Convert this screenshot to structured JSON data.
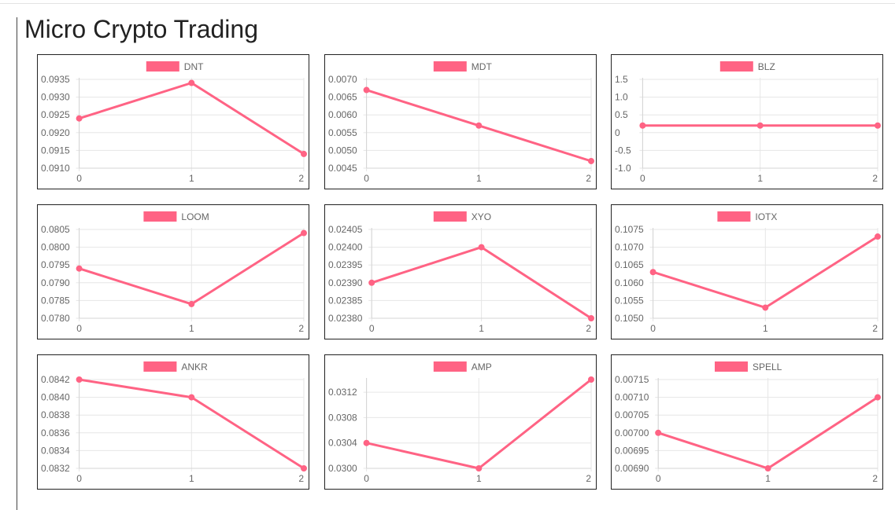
{
  "page": {
    "title": "Micro Crypto Trading"
  },
  "colors": {
    "series": "#ff6384",
    "grid": "#e6e6e6",
    "axis_text": "#666666"
  },
  "chart_data": [
    {
      "type": "line",
      "title": "",
      "x": [
        0,
        1,
        2
      ],
      "series": [
        {
          "name": "DNT",
          "values": [
            0.0924,
            0.0934,
            0.0914
          ]
        }
      ],
      "ylim": [
        0.091,
        0.0935
      ],
      "yticks": [
        "0.0935",
        "0.0930",
        "0.0925",
        "0.0920",
        "0.0915",
        "0.0910"
      ],
      "xticks": [
        "0",
        "1",
        "2"
      ],
      "grid": true,
      "legend": "top"
    },
    {
      "type": "line",
      "title": "",
      "x": [
        0,
        1,
        2
      ],
      "series": [
        {
          "name": "MDT",
          "values": [
            0.0067,
            0.0057,
            0.0047
          ]
        }
      ],
      "ylim": [
        0.0045,
        0.007
      ],
      "yticks": [
        "0.0070",
        "0.0065",
        "0.0060",
        "0.0055",
        "0.0050",
        "0.0045"
      ],
      "xticks": [
        "0",
        "1",
        "2"
      ],
      "grid": true,
      "legend": "top"
    },
    {
      "type": "line",
      "title": "",
      "x": [
        0,
        1,
        2
      ],
      "series": [
        {
          "name": "BLZ",
          "values": [
            0.2,
            0.2,
            0.2
          ]
        }
      ],
      "ylim": [
        -1.0,
        1.5
      ],
      "yticks": [
        "1.5",
        "1.0",
        "0.5",
        "0",
        "-0.5",
        "-1.0"
      ],
      "xticks": [
        "0",
        "1",
        "2"
      ],
      "grid": true,
      "legend": "top"
    },
    {
      "type": "line",
      "title": "",
      "x": [
        0,
        1,
        2
      ],
      "series": [
        {
          "name": "LOOM",
          "values": [
            0.0794,
            0.0784,
            0.0804
          ]
        }
      ],
      "ylim": [
        0.078,
        0.0805
      ],
      "yticks": [
        "0.0805",
        "0.0800",
        "0.0795",
        "0.0790",
        "0.0785",
        "0.0780"
      ],
      "xticks": [
        "0",
        "1",
        "2"
      ],
      "grid": true,
      "legend": "top"
    },
    {
      "type": "line",
      "title": "",
      "x": [
        0,
        1,
        2
      ],
      "series": [
        {
          "name": "XYO",
          "values": [
            0.0239,
            0.024,
            0.0238
          ]
        }
      ],
      "ylim": [
        0.0238,
        0.02405
      ],
      "yticks": [
        "0.02405",
        "0.02400",
        "0.02395",
        "0.02390",
        "0.02385",
        "0.02380"
      ],
      "xticks": [
        "0",
        "1",
        "2"
      ],
      "grid": true,
      "legend": "top"
    },
    {
      "type": "line",
      "title": "",
      "x": [
        0,
        1,
        2
      ],
      "series": [
        {
          "name": "IOTX",
          "values": [
            0.1063,
            0.1053,
            0.1073
          ]
        }
      ],
      "ylim": [
        0.105,
        0.1075
      ],
      "yticks": [
        "0.1075",
        "0.1070",
        "0.1065",
        "0.1060",
        "0.1055",
        "0.1050"
      ],
      "xticks": [
        "0",
        "1",
        "2"
      ],
      "grid": true,
      "legend": "top"
    },
    {
      "type": "line",
      "title": "",
      "x": [
        0,
        1,
        2
      ],
      "series": [
        {
          "name": "ANKR",
          "values": [
            0.0842,
            0.084,
            0.0832
          ]
        }
      ],
      "ylim": [
        0.0832,
        0.0842
      ],
      "yticks": [
        "0.0842",
        "0.0840",
        "0.0838",
        "0.0836",
        "0.0834",
        "0.0832"
      ],
      "xticks": [
        "0",
        "1",
        "2"
      ],
      "grid": true,
      "legend": "top"
    },
    {
      "type": "line",
      "title": "",
      "x": [
        0,
        1,
        2
      ],
      "series": [
        {
          "name": "AMP",
          "values": [
            0.0304,
            0.03,
            0.0314
          ]
        }
      ],
      "ylim": [
        0.03,
        0.0314
      ],
      "yticks": [
        "0.0312",
        "0.0308",
        "0.0304",
        "0.0300"
      ],
      "xticks": [
        "0",
        "1",
        "2"
      ],
      "grid": true,
      "legend": "top"
    },
    {
      "type": "line",
      "title": "",
      "x": [
        0,
        1,
        2
      ],
      "series": [
        {
          "name": "SPELL",
          "values": [
            0.007,
            0.0069,
            0.0071
          ]
        }
      ],
      "ylim": [
        0.0069,
        0.00715
      ],
      "yticks": [
        "0.00715",
        "0.00710",
        "0.00705",
        "0.00700",
        "0.00695",
        "0.00690"
      ],
      "xticks": [
        "0",
        "1",
        "2"
      ],
      "grid": true,
      "legend": "top"
    }
  ]
}
